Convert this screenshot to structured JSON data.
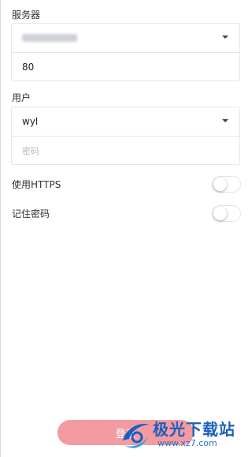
{
  "server": {
    "label": "服务器",
    "host_value": "",
    "port_value": "80"
  },
  "user": {
    "label": "用户",
    "username_value": "wyl",
    "password_placeholder": "密码"
  },
  "options": {
    "https_label": "使用HTTPS",
    "https_enabled": false,
    "remember_label": "记住密码",
    "remember_enabled": false
  },
  "submit": {
    "label": "登录"
  },
  "watermark": {
    "brand": "极光下载站",
    "url": "www.xz7.com"
  },
  "colors": {
    "submit_bg": "#f39ba1",
    "watermark_blue": "#1b5fbf"
  }
}
